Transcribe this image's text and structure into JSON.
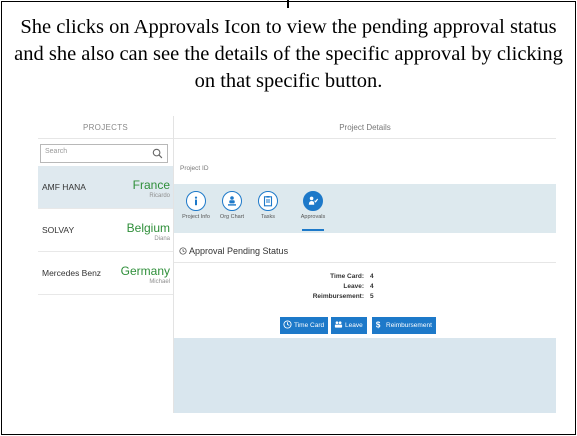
{
  "caption": "She clicks on Approvals Icon to view the pending approval status and she also can see the details of the specific approval by clicking on that specific button.",
  "projects": {
    "header": "PROJECTS",
    "search_placeholder": "Search",
    "items": [
      {
        "name": "AMF HANA",
        "country": "France",
        "person": "Ricardo"
      },
      {
        "name": "SOLVAY",
        "country": "Belgium",
        "person": "Diana"
      },
      {
        "name": "Mercedes Benz",
        "country": "Germany",
        "person": "Michael"
      }
    ]
  },
  "details": {
    "header": "Project Details",
    "project_id_label": "Project ID",
    "tabs": [
      {
        "label": "Project Info",
        "icon": "info-icon"
      },
      {
        "label": "Org Chart",
        "icon": "org-chart-icon"
      },
      {
        "label": "Tasks",
        "icon": "tasks-icon"
      },
      {
        "label": "Approvals",
        "icon": "approvals-icon"
      }
    ],
    "status_title": "Approval Pending Status",
    "stats": [
      {
        "label": "Time Card:",
        "value": "4"
      },
      {
        "label": "Leave:",
        "value": "4"
      },
      {
        "label": "Reimbursement:",
        "value": "5"
      }
    ],
    "buttons": [
      {
        "label": "Time Card",
        "icon": "timecard-icon"
      },
      {
        "label": "Leave",
        "icon": "leave-icon"
      },
      {
        "label": "Reimbursement",
        "icon": "reimbursement-icon"
      }
    ]
  },
  "colors": {
    "accent": "#1d79c9",
    "country_green": "#2f8f3a",
    "selected_bg": "#dfe9ef",
    "band_bg": "#dde9ee"
  }
}
